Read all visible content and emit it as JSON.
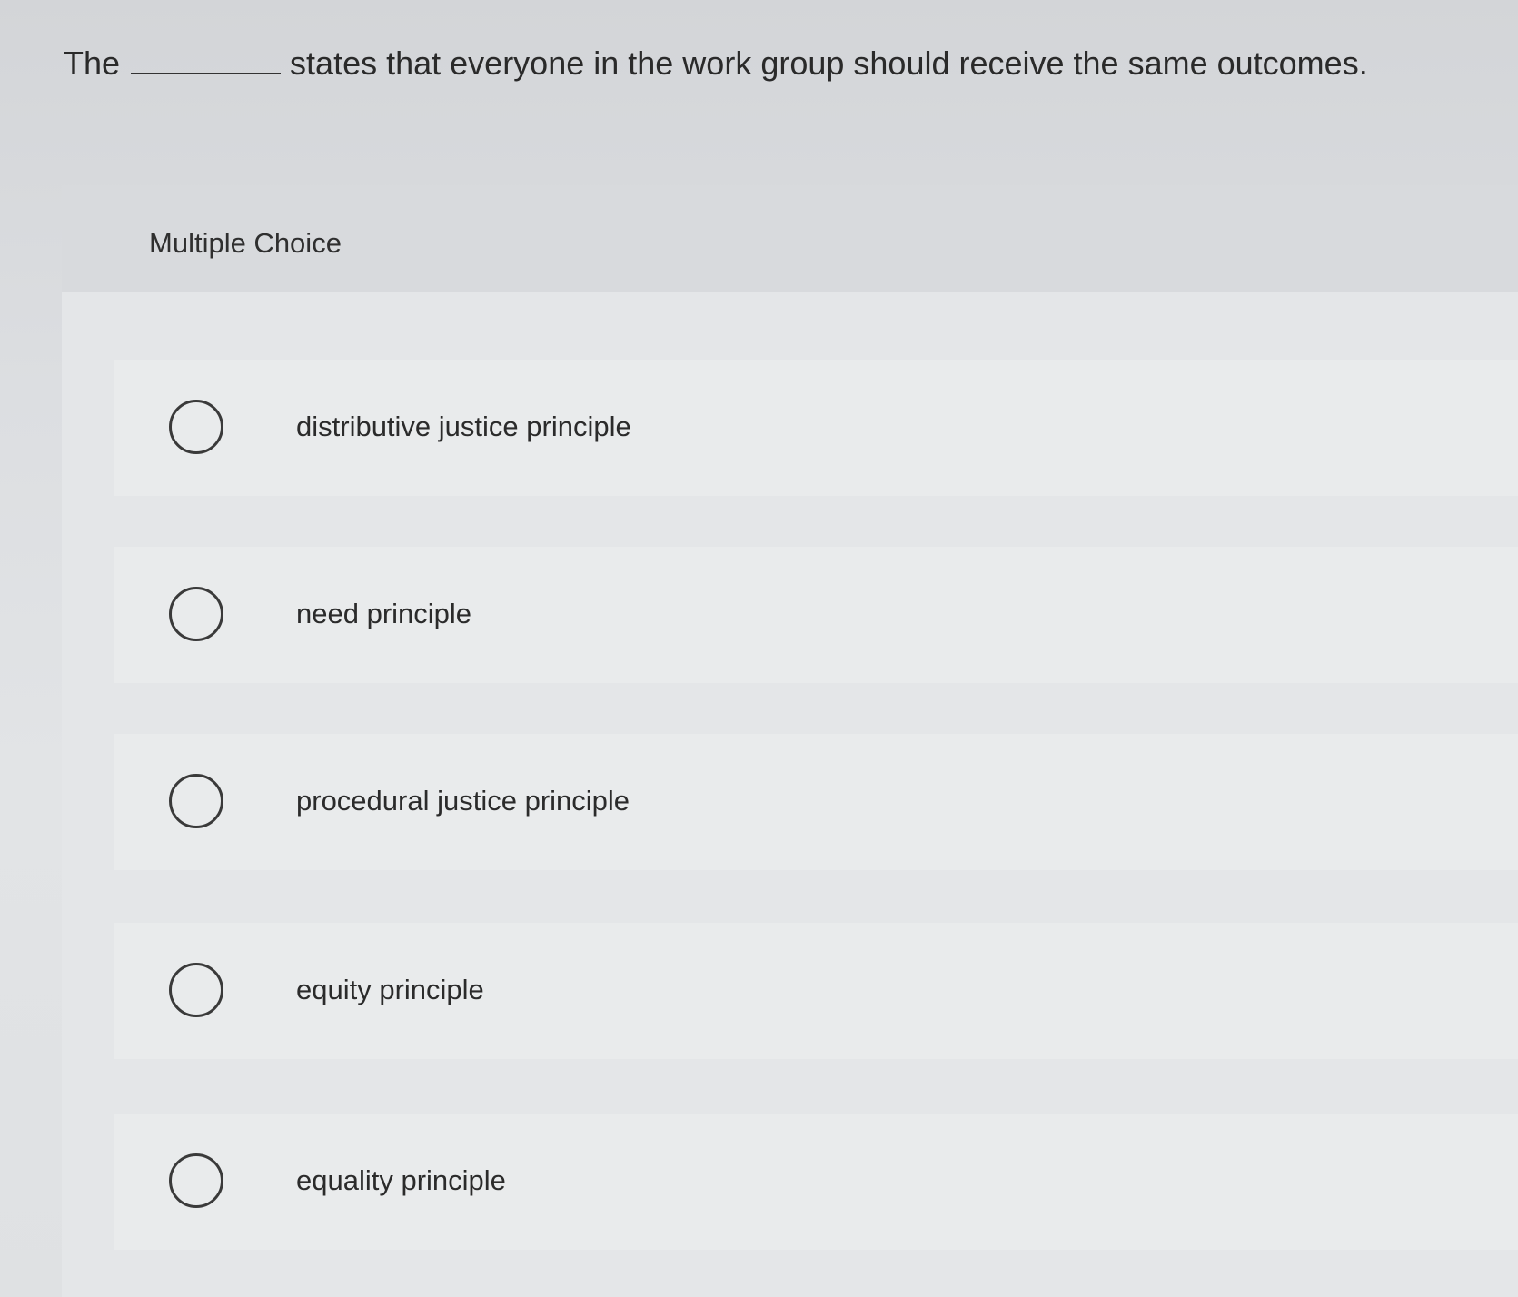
{
  "question": {
    "prefix": "The",
    "suffix": "states that everyone in the work group should receive the same outcomes."
  },
  "section": {
    "label": "Multiple Choice"
  },
  "options": [
    {
      "label": "distributive justice principle"
    },
    {
      "label": "need principle"
    },
    {
      "label": "procedural justice principle"
    },
    {
      "label": "equity principle"
    },
    {
      "label": "equality principle"
    }
  ]
}
